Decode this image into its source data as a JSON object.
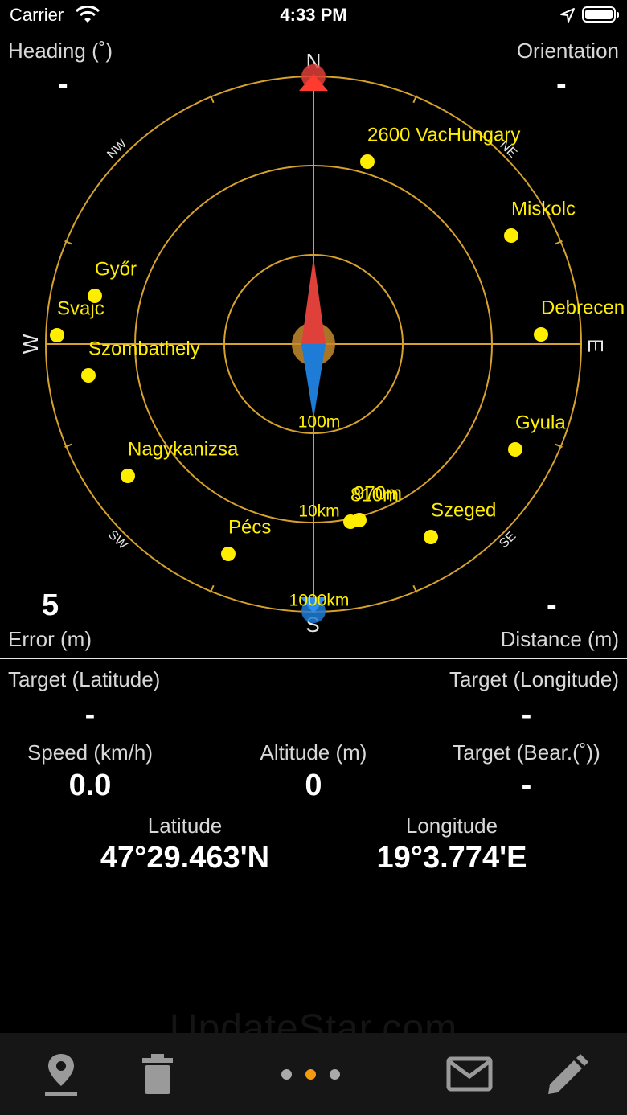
{
  "status_bar": {
    "carrier": "Carrier",
    "time": "4:33 PM"
  },
  "compass": {
    "heading_label": "Heading (˚)",
    "heading_value": "-",
    "orientation_label": "Orientation",
    "orientation_value": "-",
    "error_label": "Error (m)",
    "error_value": "5",
    "distance_label": "Distance (m)",
    "distance_value": "-",
    "directions": {
      "n": "N",
      "s": "S",
      "e": "E",
      "w": "W",
      "ne": "NE",
      "nw": "NW",
      "se": "SE",
      "sw": "SW"
    },
    "ring_labels": {
      "inner": "100m",
      "middle": "10km",
      "outer": "1000km"
    },
    "places": [
      {
        "name": "2600 VacHungary"
      },
      {
        "name": "Miskolc"
      },
      {
        "name": "Győr"
      },
      {
        "name": "Svajc"
      },
      {
        "name": "Debrecen"
      },
      {
        "name": "Szombathely"
      },
      {
        "name": "Gyula"
      },
      {
        "name": "Nagykanizsa"
      },
      {
        "name": "Szeged"
      },
      {
        "name": "Pécs"
      },
      {
        "name": "970m"
      },
      {
        "name": "810m"
      }
    ],
    "colors": {
      "ring": "#d6a12c",
      "place": "#ffee00",
      "needle_north": "#e0403a",
      "needle_south": "#1e7bd6"
    }
  },
  "info": {
    "target_lat_label": "Target (Latitude)",
    "target_lat_value": "-",
    "target_lon_label": "Target (Longitude)",
    "target_lon_value": "-",
    "speed_label": "Speed (km/h)",
    "speed_value": "0.0",
    "altitude_label": "Altitude (m)",
    "altitude_value": "0",
    "target_bear_label": "Target (Bear.(˚))",
    "target_bear_value": "-",
    "latitude_label": "Latitude",
    "latitude_value": "47°29.463'N",
    "longitude_label": "Longitude",
    "longitude_value": "19°3.774'E"
  },
  "toolbar": {
    "icons": [
      "location-pin-icon",
      "trash-icon",
      "page-dots",
      "mail-icon",
      "pencil-icon"
    ],
    "page_count": 3,
    "active_page": 2
  },
  "watermark": "UpdateStar.com"
}
